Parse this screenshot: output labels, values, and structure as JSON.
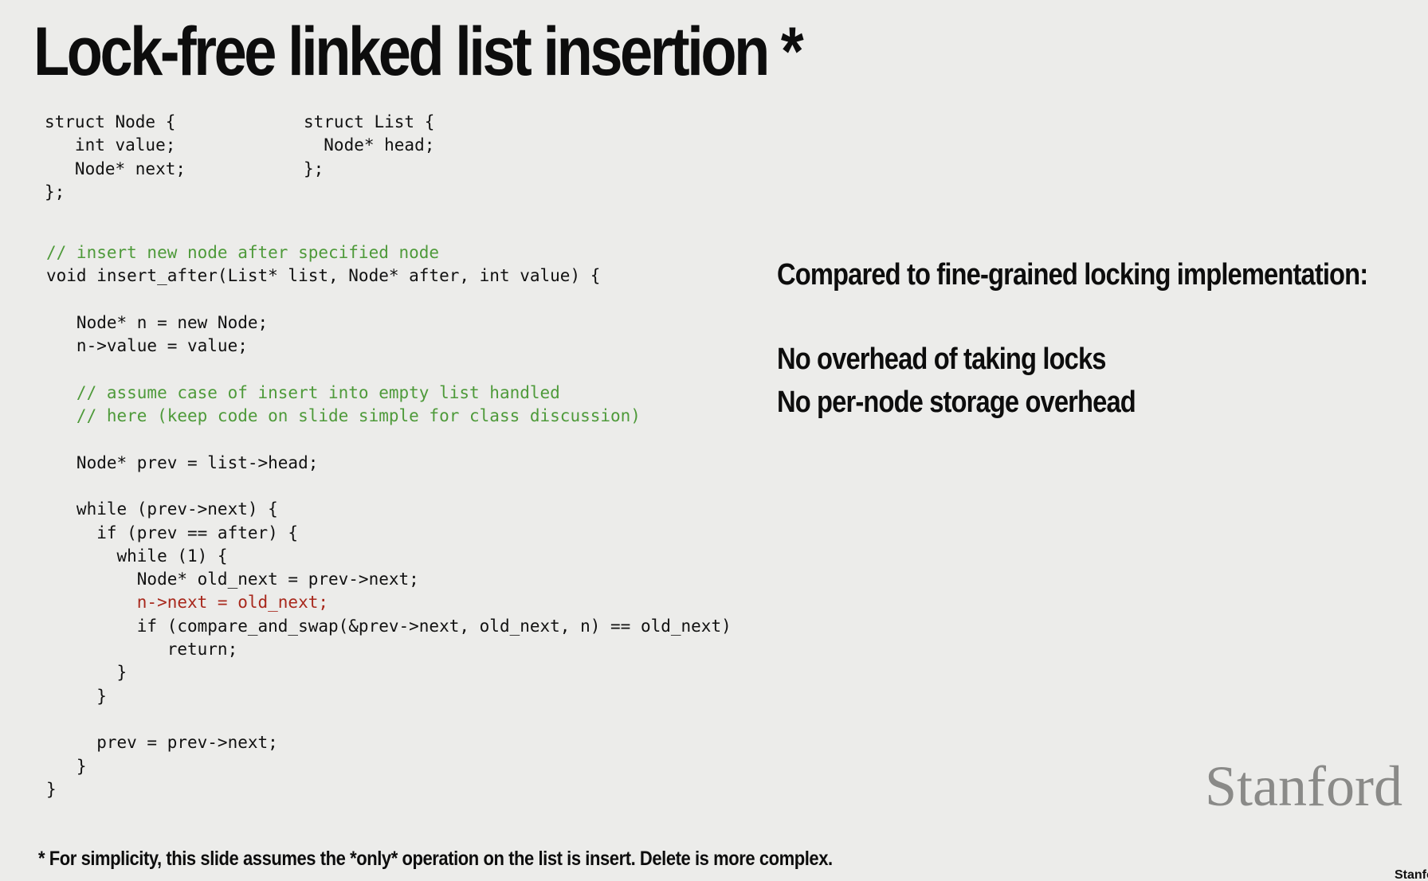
{
  "slide": {
    "title": "Lock-free linked list insertion *",
    "struct_node": [
      "struct Node {",
      "   int value;",
      "   Node* next;",
      "};"
    ],
    "struct_list": [
      "struct List {",
      "  Node* head;",
      "};"
    ],
    "code_lines": [
      {
        "text": "// insert new node after specified node",
        "style": "comment"
      },
      {
        "text": "void insert_after(List* list, Node* after, int value) {",
        "style": "normal"
      },
      {
        "text": "",
        "style": "normal"
      },
      {
        "text": "   Node* n = new Node;",
        "style": "normal"
      },
      {
        "text": "   n->value = value;",
        "style": "normal"
      },
      {
        "text": "",
        "style": "normal"
      },
      {
        "text": "   // assume case of insert into empty list handled",
        "style": "comment"
      },
      {
        "text": "   // here (keep code on slide simple for class discussion)",
        "style": "comment"
      },
      {
        "text": "",
        "style": "normal"
      },
      {
        "text": "   Node* prev = list->head;",
        "style": "normal"
      },
      {
        "text": "",
        "style": "normal"
      },
      {
        "text": "   while (prev->next) {",
        "style": "normal"
      },
      {
        "text": "     if (prev == after) {",
        "style": "normal"
      },
      {
        "text": "       while (1) {",
        "style": "normal"
      },
      {
        "text": "         Node* old_next = prev->next;",
        "style": "normal"
      },
      {
        "text": "         n->next = old_next;",
        "style": "highlight"
      },
      {
        "text": "         if (compare_and_swap(&prev->next, old_next, n) == old_next)",
        "style": "normal"
      },
      {
        "text": "            return;",
        "style": "normal"
      },
      {
        "text": "       }",
        "style": "normal"
      },
      {
        "text": "     }",
        "style": "normal"
      },
      {
        "text": "",
        "style": "normal"
      },
      {
        "text": "     prev = prev->next;",
        "style": "normal"
      },
      {
        "text": "   }",
        "style": "normal"
      },
      {
        "text": "}",
        "style": "normal"
      }
    ],
    "comparison_heading": "Compared to fine-grained locking implementation:",
    "points": [
      "No overhead of taking locks",
      "No per-node storage overhead"
    ],
    "footnote": "* For simplicity, this slide assumes the *only* operation on the list is insert. Delete is more complex.",
    "logo_text": "Stanford",
    "corner_text": "Stanford",
    "colors": {
      "background": "#ececea",
      "comment": "#4e9a3a",
      "highlight": "#a8281c",
      "logo": "#8a8a88"
    }
  }
}
